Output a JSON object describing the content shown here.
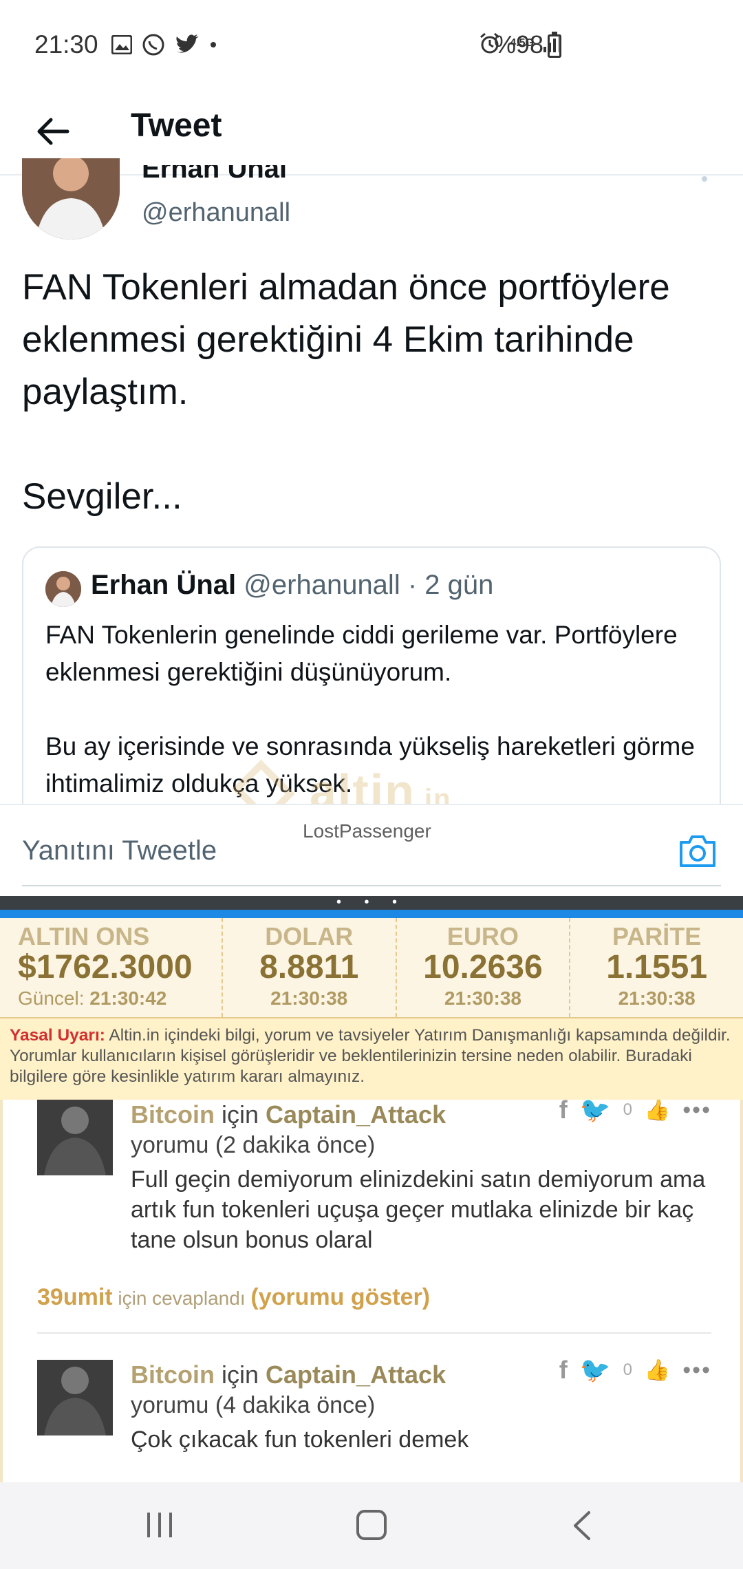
{
  "status_bar": {
    "time": "21:30",
    "network": "4.5G",
    "battery": "%98",
    "icons": [
      "image-icon",
      "whatsapp-icon",
      "twitter-icon",
      "dot-icon",
      "alarm-icon",
      "data-arrows-icon",
      "signal-icon",
      "battery-icon"
    ]
  },
  "header": {
    "title": "Tweet",
    "back_icon": "back-arrow-icon"
  },
  "tweet": {
    "author_name": "Erhan Ünal",
    "author_handle": "@erhanunall",
    "paragraph1": "FAN Tokenleri almadan önce portföylere eklenmesi gerektiğini 4 Ekim tarihinde paylaştım.",
    "paragraph2": "Sevgiler..."
  },
  "quoted_tweet": {
    "name": "Erhan Ünal",
    "handle": "@erhanunall",
    "separator": " · ",
    "time": "2 gün",
    "line1": "FAN Tokenlerin genelinde ciddi gerileme var. Portföylere eklenmesi gerektiğini düşünüyorum.",
    "line2": "Bu ay içerisinde ve sonrasında yükseliş hareketleri görme ihtimalimiz oldukça yüksek."
  },
  "watermark": {
    "text": "altin",
    "suffix": ".in"
  },
  "reply_bar": {
    "placeholder": "Yanıtını Tweetle",
    "username": "LostPassenger"
  },
  "rates": [
    {
      "title": "ALTIN ONS",
      "value": "$1762.3000",
      "time_label": "Güncel:",
      "time": "21:30:42"
    },
    {
      "title": "DOLAR",
      "value": "8.8811",
      "time": "21:30:38"
    },
    {
      "title": "EURO",
      "value": "10.2636",
      "time": "21:30:38"
    },
    {
      "title": "PARİTE",
      "value": "1.1551",
      "time": "21:30:38"
    }
  ],
  "warning": {
    "label": "Yasal Uyarı:",
    "text": " Altin.in içindeki bilgi, yorum ve tavsiyeler Yatırım Danışmanlığı kapsamında değildir. Yorumlar kullanıcıların kişisel görüşleridir ve beklentilerinizin tersine neden olabilir. Buradaki bilgilere göre kesinlikle yatırım kararı almayınız."
  },
  "comments": [
    {
      "coin": "Bitcoin",
      "for": " için ",
      "user": "Captain_Attack",
      "ago": "yorumu (2 dakika önce)",
      "text": "Full geçin demiyorum elinizdekini satın demiyorum ama artık fun tokenleri uçuşa geçer mutlaka elinizde bir kaç tane olsun bonus olaral",
      "likes": "0"
    },
    {
      "coin": "Bitcoin",
      "for": " için ",
      "user": "Captain_Attack",
      "ago": "yorumu (4 dakika önce)",
      "text": "Çok çıkacak fun tokenleri demek",
      "likes": "0"
    }
  ],
  "replied": {
    "user": "39umit",
    "label": " için cevaplandı ",
    "show": "(yorumu göster)"
  }
}
